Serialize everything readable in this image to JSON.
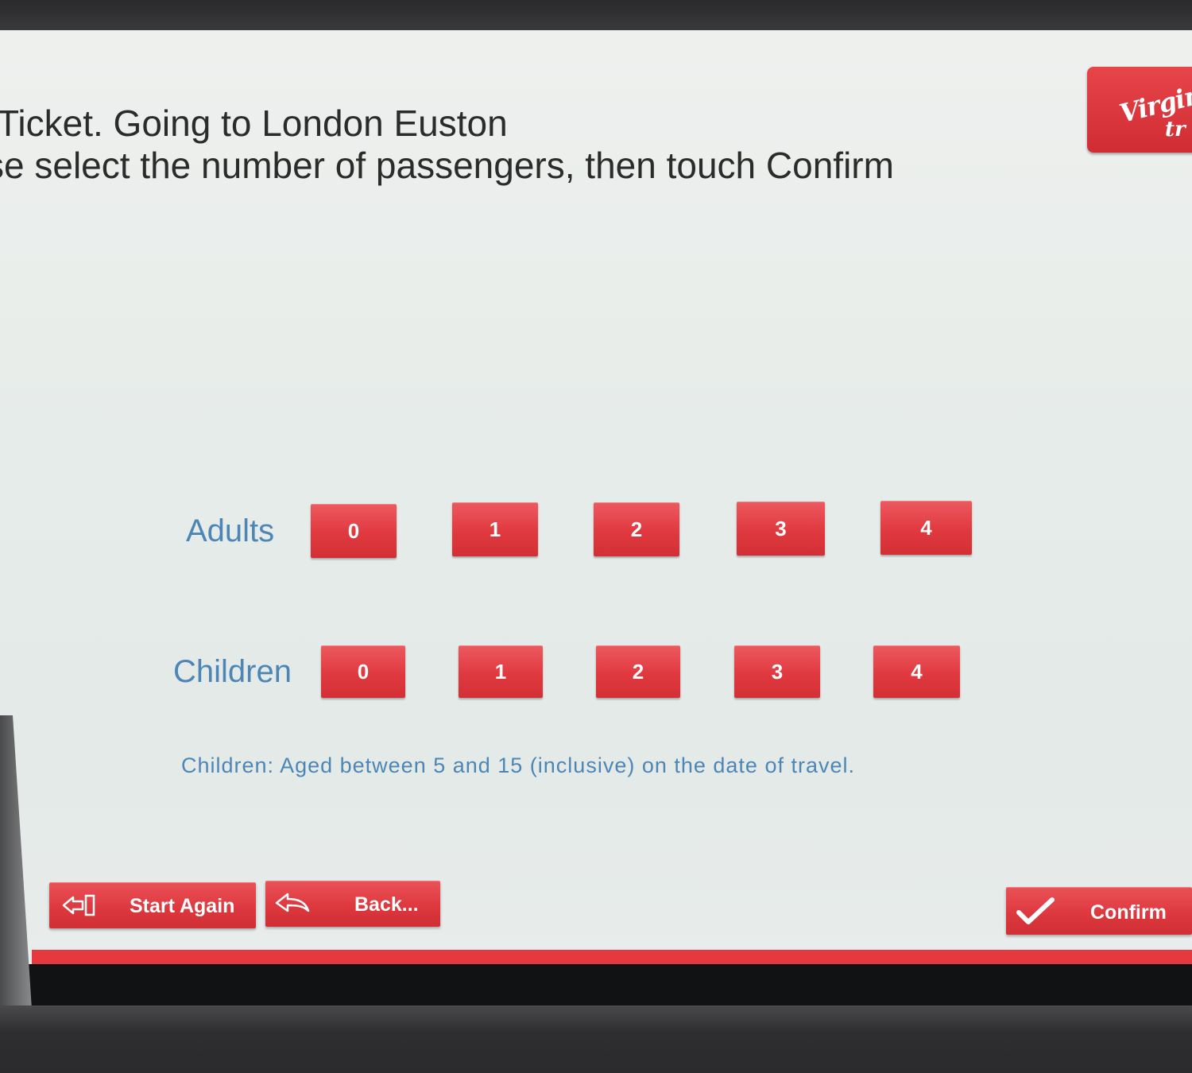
{
  "header": {
    "title": "Ticket. Going to London Euston",
    "instruction": "se select the number of passengers, then touch Confirm"
  },
  "logo": {
    "brand": "Virgin",
    "sub": "tr",
    "icon": "virgin-trains-logo",
    "color": "#e0393f"
  },
  "adults": {
    "label": "Adults",
    "options": [
      "0",
      "1",
      "2",
      "3",
      "4"
    ]
  },
  "children": {
    "label": "Children",
    "options": [
      "0",
      "1",
      "2",
      "3",
      "4"
    ],
    "note": "Children: Aged between 5 and 15 (inclusive) on the date of travel."
  },
  "nav": {
    "start_again": {
      "label": "Start Again",
      "icon": "exit-arrow-icon"
    },
    "back": {
      "label": "Back...",
      "icon": "back-arrow-icon"
    },
    "confirm": {
      "label": "Confirm",
      "icon": "checkmark-icon"
    }
  },
  "colors": {
    "accent": "#e0393f",
    "label_blue": "#4d86b5",
    "text": "#2b2b2b"
  }
}
